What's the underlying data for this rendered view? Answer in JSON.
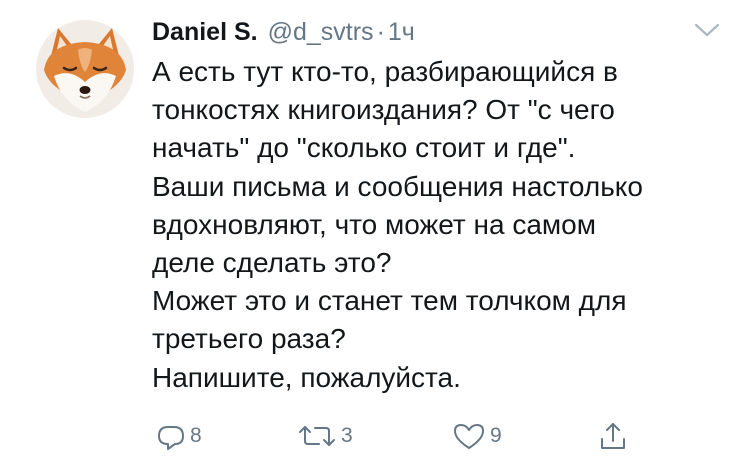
{
  "tweet": {
    "author_name": "Daniel S.",
    "handle": "@d_svtrs",
    "separator": "·",
    "timestamp": "1ч",
    "body_lines": [
      "А есть тут кто-то, разбирающийся в",
      "тонкостях книгоиздания? От \"с чего",
      "начать\" до \"сколько стоит и где\".",
      "Ваши письма и сообщения настолько",
      "вдохновляют, что может на самом",
      "деле сделать это?",
      "Может это и станет тем толчком для",
      "третьего раза?",
      "Напишите, пожалуйста."
    ]
  },
  "actions": {
    "reply_count": "8",
    "retweet_count": "3",
    "like_count": "9"
  },
  "icons": {
    "avatar": "fox-avatar",
    "caret": "chevron-down-icon",
    "reply": "reply-icon",
    "retweet": "retweet-icon",
    "like": "heart-icon",
    "share": "share-icon"
  },
  "colors": {
    "text_primary": "#14171a",
    "text_secondary": "#657786",
    "background": "#ffffff"
  }
}
